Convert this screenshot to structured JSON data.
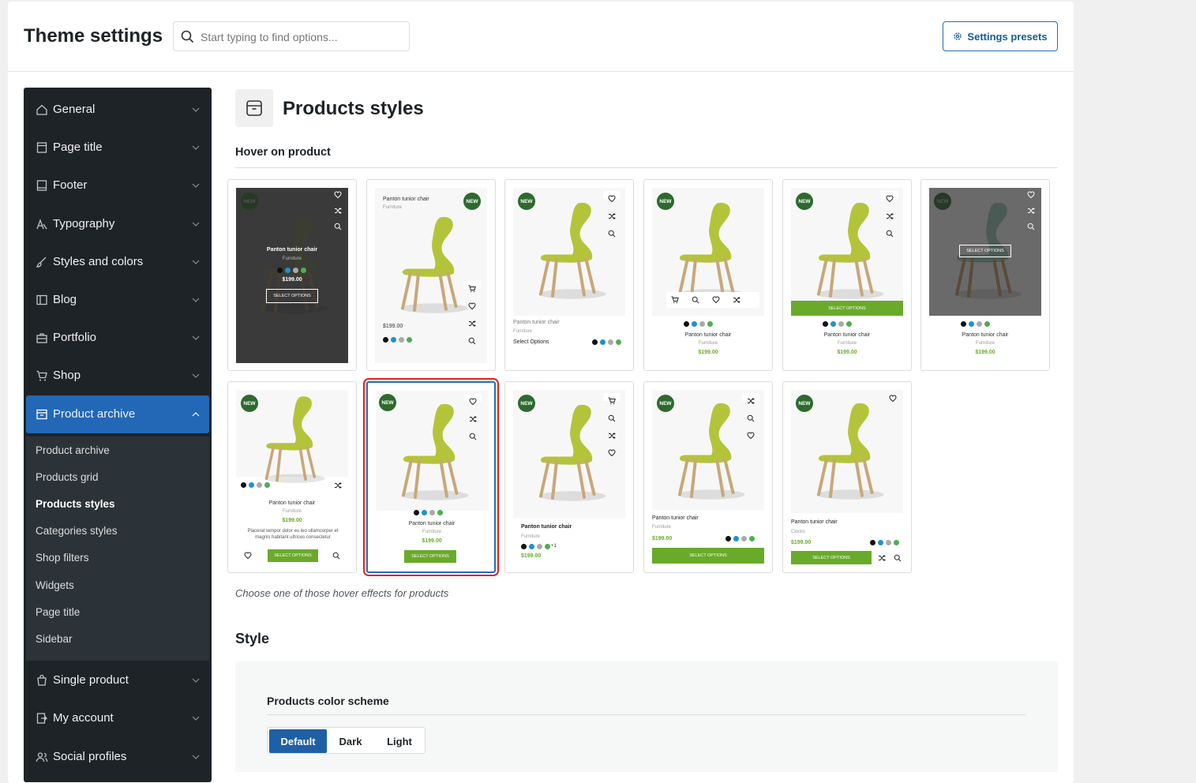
{
  "header": {
    "title": "Theme settings",
    "search_placeholder": "Start typing to find options...",
    "presets_label": "Settings presets"
  },
  "sidebar": {
    "items": [
      {
        "label": "General",
        "icon": "home-icon"
      },
      {
        "label": "Page title",
        "icon": "page-icon"
      },
      {
        "label": "Footer",
        "icon": "footer-icon"
      },
      {
        "label": "Typography",
        "icon": "typography-icon"
      },
      {
        "label": "Styles and colors",
        "icon": "brush-icon"
      },
      {
        "label": "Blog",
        "icon": "blog-icon"
      },
      {
        "label": "Portfolio",
        "icon": "briefcase-icon"
      },
      {
        "label": "Shop",
        "icon": "cart-icon"
      },
      {
        "label": "Product archive",
        "icon": "archive-icon"
      },
      {
        "label": "Single product",
        "icon": "bag-icon"
      },
      {
        "label": "My account",
        "icon": "account-icon"
      },
      {
        "label": "Social profiles",
        "icon": "people-icon"
      }
    ],
    "sub_items": [
      "Product archive",
      "Products grid",
      "Products styles",
      "Categories styles",
      "Shop filters",
      "Widgets",
      "Page title",
      "Sidebar"
    ]
  },
  "section": {
    "title": "Products styles",
    "option_label": "Hover on product",
    "hint": "Choose one of those hover effects for products",
    "style_heading": "Style",
    "scheme_label": "Products color scheme",
    "scheme_options": [
      "Default",
      "Dark",
      "Light"
    ],
    "scheme_selected": "Default"
  },
  "product": {
    "title": "Panton tunior chair",
    "category": "Furniture",
    "category_alt": "Clocks",
    "price": "$199.00",
    "badge": "NEW",
    "button": "SELECT OPTIONS",
    "button_alt": "Select Options",
    "excerpt": "Placerat tempor dolor eu leo ullamcorper et magnis habitant ultrices consectetur",
    "more_colors": "+1",
    "swatches": [
      "#111111",
      "#1e90d6",
      "#aaaaaa",
      "#4caf50"
    ]
  },
  "hover_styles": {
    "count": 11,
    "selected_index": 8
  }
}
